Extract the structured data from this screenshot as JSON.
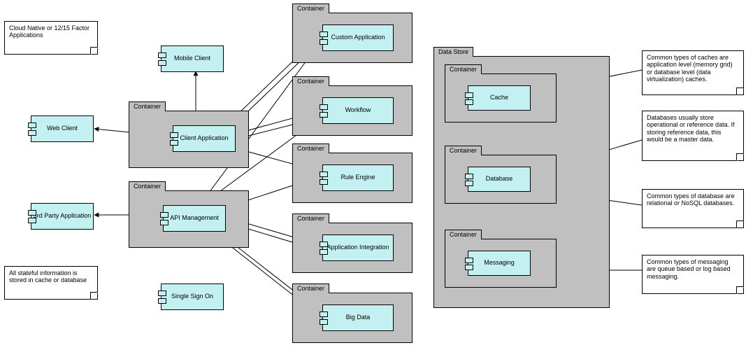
{
  "notes": {
    "cloud_native": "Cloud Native or 12/15 Factor Applications",
    "stateful": "All stateful information is stored in cache or database",
    "cache": "Common types of caches are application level (memory grid) or database level (data virtualization) caches.",
    "db_ref": "Databases usually store operational or reference data. If storing reference data, this would be a master data.",
    "db_types": "Common types of database are relational or NoSQL databases.",
    "msg": "Common types of messaging are queue based or log based messaging."
  },
  "labels": {
    "container": "Container",
    "data_store": "Data Store"
  },
  "components": {
    "mobile_client": "Mobile Client",
    "web_client": "Web Client",
    "third_party": "3rd Party Application",
    "single_sign_on": "Single Sign On",
    "client_app": "Client Application",
    "api_mgmt": "API Management",
    "custom_app": "Custom Application",
    "workflow": "Workflow",
    "rule_engine": "Rule Engine",
    "app_integration": "Application Integration",
    "big_data": "Big Data",
    "cache": "Cache",
    "database": "Database",
    "messaging": "Messaging"
  }
}
